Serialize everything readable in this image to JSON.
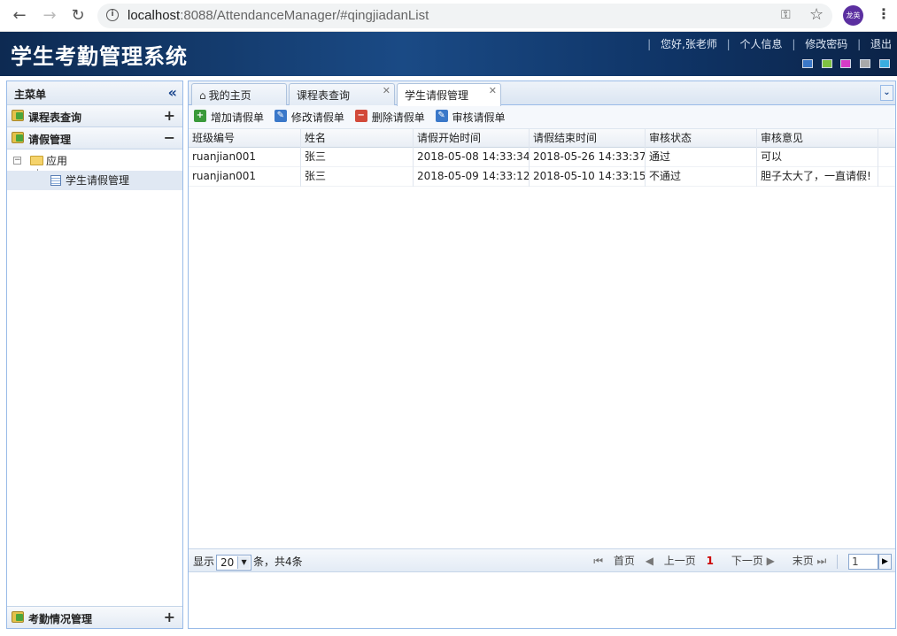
{
  "browser": {
    "url_host": "localhost",
    "url_rest": ":8088/AttendanceManager/#qingjiadanList",
    "avatar_text": "龙英"
  },
  "header": {
    "title": "学生考勤管理系统",
    "greeting": "您好,张老师",
    "profile": "个人信息",
    "change_password": "修改密码",
    "logout": "退出",
    "theme_colors": [
      "#3a78c9",
      "#7fc242",
      "#d63bc6",
      "#a9a9a9",
      "#3aaee0"
    ]
  },
  "sidebar": {
    "title": "主菜单",
    "sections": [
      {
        "label": "课程表查询",
        "toggle": "+"
      },
      {
        "label": "请假管理",
        "toggle": "−"
      }
    ],
    "tree": {
      "root": "应用",
      "leaf": "学生请假管理"
    },
    "bottom_section": {
      "label": "考勤情况管理",
      "toggle": "+"
    }
  },
  "tabs": [
    {
      "label": "我的主页",
      "closable": false
    },
    {
      "label": "课程表查询",
      "closable": true
    },
    {
      "label": "学生请假管理",
      "closable": true,
      "active": true
    }
  ],
  "toolbar": {
    "add": "增加请假单",
    "edit": "修改请假单",
    "delete": "删除请假单",
    "audit": "审核请假单"
  },
  "grid": {
    "columns": [
      "班级编号",
      "姓名",
      "请假开始时间",
      "请假结束时间",
      "审核状态",
      "审核意见"
    ],
    "rows": [
      [
        "ruanjian001",
        "张三",
        "2018-05-08 14:33:34",
        "2018-05-26 14:33:37",
        "通过",
        "可以"
      ],
      [
        "ruanjian001",
        "张三",
        "2018-05-09 14:33:12",
        "2018-05-10 14:33:15",
        "不通过",
        "胆子太大了，一直请假!"
      ]
    ]
  },
  "pager": {
    "show": "显示",
    "page_size": "20",
    "total_text": "条，共4条",
    "first": "首页",
    "prev": "上一页",
    "current": "1",
    "next": "下一页",
    "last": "末页",
    "page_input": "1"
  }
}
